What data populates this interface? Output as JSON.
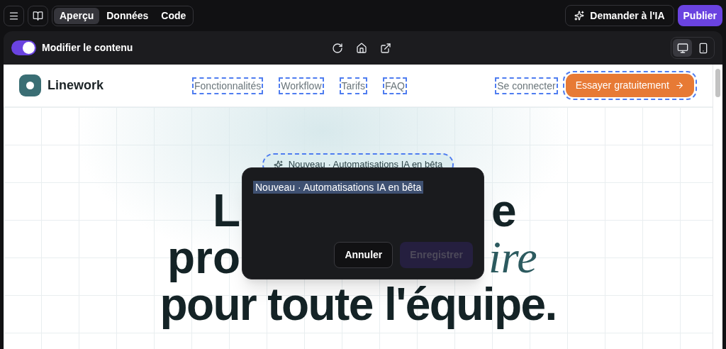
{
  "toolbar": {
    "tabs": [
      {
        "label": "Aperçu",
        "selected": true
      },
      {
        "label": "Données",
        "selected": false
      },
      {
        "label": "Code",
        "selected": false
      }
    ],
    "ask_ai": "Demander à l'IA",
    "publish": "Publier"
  },
  "preview_bar": {
    "edit_toggle": {
      "label": "Modifier le contenu",
      "on": true
    },
    "devices": [
      {
        "kind": "desktop",
        "selected": true
      },
      {
        "kind": "mobile",
        "selected": false
      }
    ]
  },
  "site": {
    "brand": "Linework",
    "nav": [
      "Fonctionnalités",
      "Workflow",
      "Tarifs",
      "FAQ"
    ],
    "login": "Se connecter",
    "cta": "Essayer gratuitement",
    "badge": "Nouveau · Automatisations IA en bêta",
    "headline": [
      {
        "kind": "split",
        "left": "L",
        "right": "e"
      },
      {
        "kind": "split_italic",
        "left": "pro",
        "right": "ire"
      },
      {
        "kind": "full",
        "text": "pour toute l'équipe."
      }
    ]
  },
  "editor": {
    "value": "Nouveau · Automatisations IA en bêta",
    "cancel": "Annuler",
    "save": "Enregistrer",
    "save_disabled": true
  }
}
